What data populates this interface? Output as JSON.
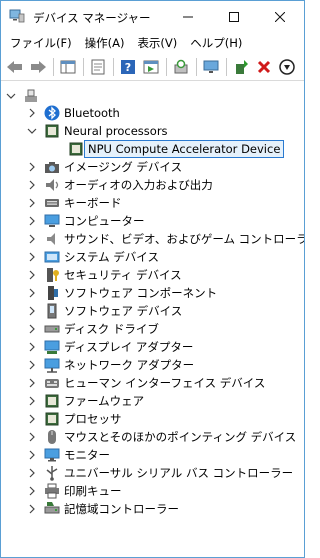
{
  "window": {
    "title": "デバイス マネージャー"
  },
  "menu": [
    "ファイル(F)",
    "操作(A)",
    "表示(V)",
    "ヘルプ(H)"
  ],
  "tree": {
    "root_label": "",
    "expanded": {
      "label": "Neural processors",
      "child": "NPU Compute Accelerator Device"
    },
    "categories": [
      {
        "label": "Bluetooth",
        "icon": "bluetooth-icon"
      },
      {
        "label": "Neural processors",
        "icon": "chip-icon"
      },
      {
        "label": "NPU Compute Accelerator Device",
        "icon": "chip-icon"
      },
      {
        "label": "イメージング デバイス",
        "icon": "camera-icon"
      },
      {
        "label": "オーディオの入力および出力",
        "icon": "speaker-icon"
      },
      {
        "label": "キーボード",
        "icon": "keyboard-icon"
      },
      {
        "label": "コンピューター",
        "icon": "computer-icon"
      },
      {
        "label": "サウンド、ビデオ、およびゲーム コントローラー",
        "icon": "speaker-icon"
      },
      {
        "label": "システム デバイス",
        "icon": "folder-icon"
      },
      {
        "label": "セキュリティ デバイス",
        "icon": "security-key-icon"
      },
      {
        "label": "ソフトウェア コンポーネント",
        "icon": "component-icon"
      },
      {
        "label": "ソフトウェア デバイス",
        "icon": "device-icon"
      },
      {
        "label": "ディスク ドライブ",
        "icon": "disk-icon"
      },
      {
        "label": "ディスプレイ アダプター",
        "icon": "display-adapter-icon"
      },
      {
        "label": "ネットワーク アダプター",
        "icon": "network-icon"
      },
      {
        "label": "ヒューマン インターフェイス デバイス",
        "icon": "hid-icon"
      },
      {
        "label": "ファームウェア",
        "icon": "chip-icon"
      },
      {
        "label": "プロセッサ",
        "icon": "chip-icon"
      },
      {
        "label": "マウスとそのほかのポインティング デバイス",
        "icon": "mouse-icon"
      },
      {
        "label": "モニター",
        "icon": "monitor-icon"
      },
      {
        "label": "ユニバーサル シリアル バス コントローラー",
        "icon": "usb-icon"
      },
      {
        "label": "印刷キュー",
        "icon": "printer-icon"
      },
      {
        "label": "記憶域コントローラー",
        "icon": "storage-controller-icon"
      }
    ]
  },
  "colors": {
    "accent": "#2a7ad0",
    "selection_bg": "#e5f1fb"
  }
}
